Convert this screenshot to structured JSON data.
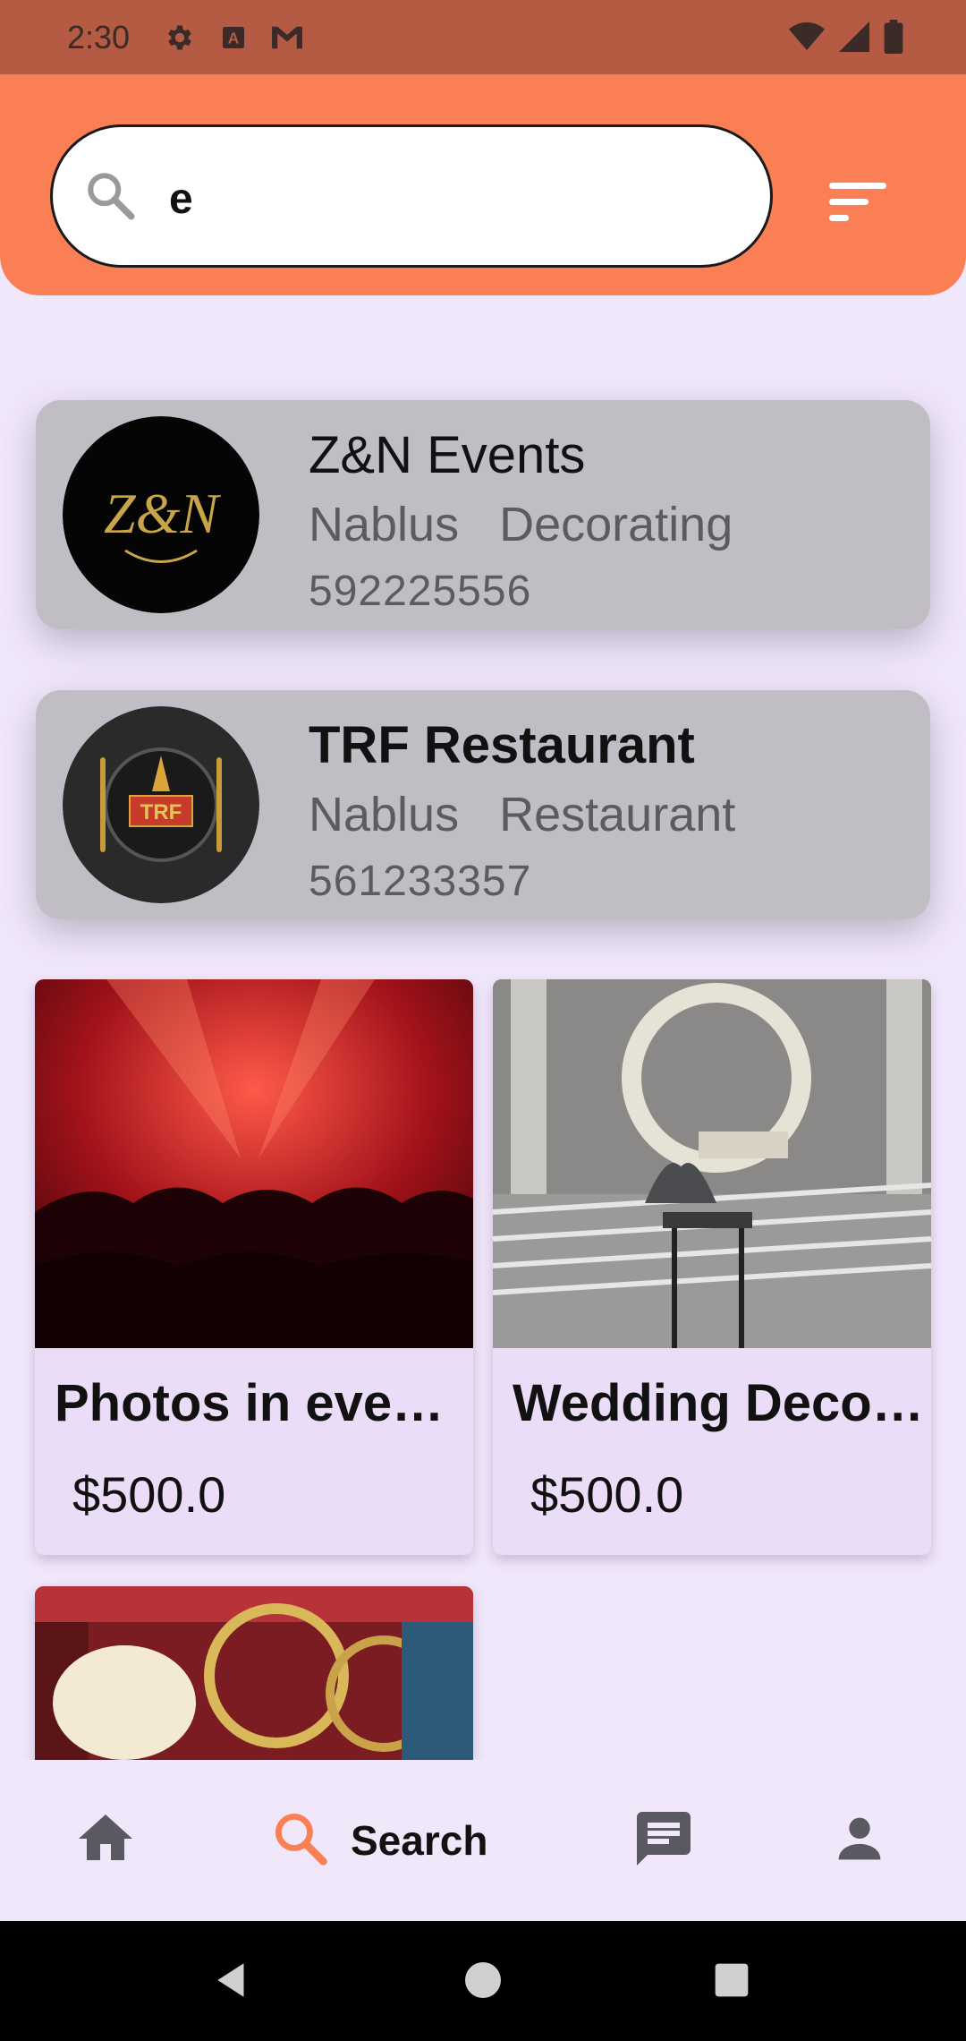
{
  "status_bar": {
    "time": "2:30",
    "icons": [
      "gear-icon",
      "a-icon",
      "gmail-icon",
      "wifi-icon",
      "signal-icon",
      "battery-icon"
    ]
  },
  "search": {
    "value": "e",
    "icon": "search-icon",
    "filter_icon": "filter-icon"
  },
  "vendors": [
    {
      "name": "Z&N Events",
      "city": "Nablus",
      "category": "Decorating",
      "phone": "592225556",
      "logo_text": "Z&N"
    },
    {
      "name": "TRF Restaurant",
      "city": "Nablus",
      "category": "Restaurant",
      "phone": "561233357",
      "logo_text": "TRF"
    }
  ],
  "products": [
    {
      "title": "Photos in even…",
      "price": "$500.0"
    },
    {
      "title": "Wedding Deco…",
      "price": "$500.0"
    }
  ],
  "nav": {
    "home_icon": "home-icon",
    "search_label": "Search",
    "chat_icon": "chat-icon",
    "profile_icon": "person-icon"
  },
  "colors": {
    "status_bar": "#b55a43",
    "header": "#fb7f55",
    "background": "#f1e7fb",
    "accent": "#fb7f55"
  }
}
